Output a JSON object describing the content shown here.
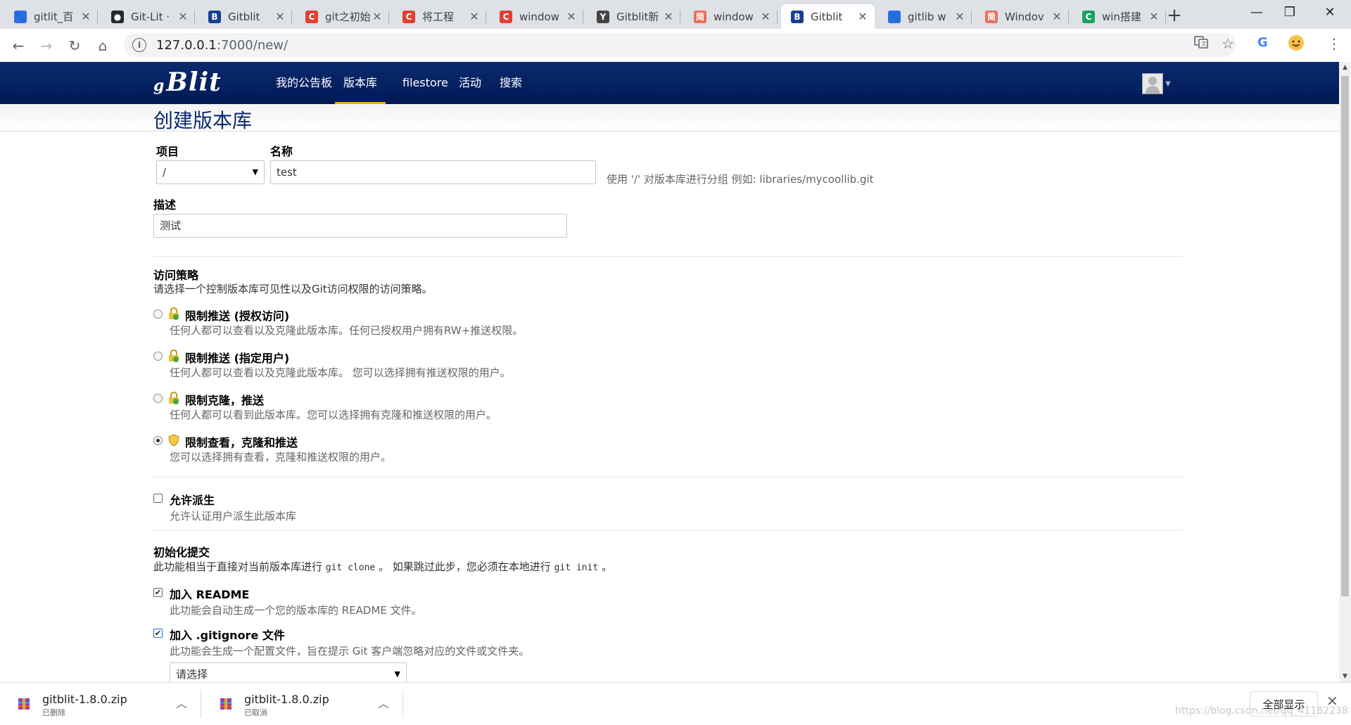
{
  "browser": {
    "tabs": [
      {
        "title": "gitlit_百",
        "icon": "baidu-paw-icon",
        "color": "#2b6de5"
      },
      {
        "title": "Git-Lit ·",
        "icon": "github-icon",
        "color": "#24292e"
      },
      {
        "title": "Gitblit",
        "icon": "gitblit-b-icon",
        "color": "#1a3f8f"
      },
      {
        "title": "git之初始",
        "icon": "csdn-c-icon",
        "color": "#e33e33"
      },
      {
        "title": "将工程",
        "icon": "csdn-c-icon",
        "color": "#e33e33"
      },
      {
        "title": "window",
        "icon": "csdn-c-icon",
        "color": "#e33e33"
      },
      {
        "title": "Gitblit新",
        "icon": "gitblit-figure-icon",
        "color": "#444444"
      },
      {
        "title": "window",
        "icon": "jianshu-icon",
        "color": "#ea6f5a"
      },
      {
        "title": "Gitblit",
        "icon": "gitblit-b-icon",
        "color": "#1a3f8f",
        "active": true
      },
      {
        "title": "gitlib w",
        "icon": "baidu-paw-icon",
        "color": "#2b6de5"
      },
      {
        "title": "Windov",
        "icon": "jianshu-icon",
        "color": "#ea6f5a"
      },
      {
        "title": "win搭建",
        "icon": "green-c-icon",
        "color": "#1aa260"
      }
    ],
    "url_host": "127.0.0.1",
    "url_rest": ":7000/new/"
  },
  "nav": {
    "logo": "Blit",
    "logo_prefix": "g",
    "items": [
      "我的公告板",
      "版本库",
      "filestore",
      "活动",
      "搜索"
    ],
    "active_index": 1
  },
  "page": {
    "title": "创建版本库",
    "project_label": "项目",
    "project_value": "/",
    "name_label": "名称",
    "name_value": "test",
    "name_hint": "使用 '/' 对版本库进行分组 例如:  libraries/mycoollib.git",
    "desc_label": "描述",
    "desc_value": "测试",
    "access": {
      "title": "访问策略",
      "desc": "请选择一个控制版本库可见性以及Git访问权限的访问策略。",
      "options": [
        {
          "label": "限制推送 (授权访问)",
          "desc": "任何人都可以查看以及克隆此版本库。任何已授权用户拥有RW+推送权限。",
          "checked": false
        },
        {
          "label": "限制推送 (指定用户)",
          "desc": "任何人都可以查看以及克隆此版本库。 您可以选择拥有推送权限的用户。",
          "checked": false
        },
        {
          "label": "限制克隆，推送",
          "desc": "任何人都可以看到此版本库。您可以选择拥有克隆和推送权限的用户。",
          "checked": false
        },
        {
          "label": "限制查看，克隆和推送",
          "desc": "您可以选择拥有查看，克隆和推送权限的用户。",
          "checked": true
        }
      ]
    },
    "fork": {
      "label": "允许派生",
      "desc": "允许认证用户派生此版本库",
      "checked": false
    },
    "init": {
      "title": "初始化提交",
      "desc_pre": "此功能相当于直接对当前版本库进行 ",
      "code1": "git clone",
      "desc_mid": " 。 如果跳过此步，您必须在本地进行 ",
      "code2": "git init",
      "desc_post": " 。",
      "readme_label": "加入 README",
      "readme_desc": "此功能会自动生成一个您的版本库的 README 文件。",
      "readme_checked": true,
      "gitignore_label": "加入 .gitignore 文件",
      "gitignore_desc": "此功能会生成一个配置文件，旨在提示 Git 客户端忽略对应的文件或文件夹。",
      "gitignore_checked": true,
      "gitignore_select": "请选择"
    }
  },
  "downloads": {
    "items": [
      {
        "name": "gitblit-1.8.0.zip",
        "status": "已删除"
      },
      {
        "name": "gitblit-1.8.0.zip",
        "status": "已取消"
      }
    ],
    "show_all": "全部显示",
    "watermark": "https://blog.csdn.net/qq_41182238"
  }
}
